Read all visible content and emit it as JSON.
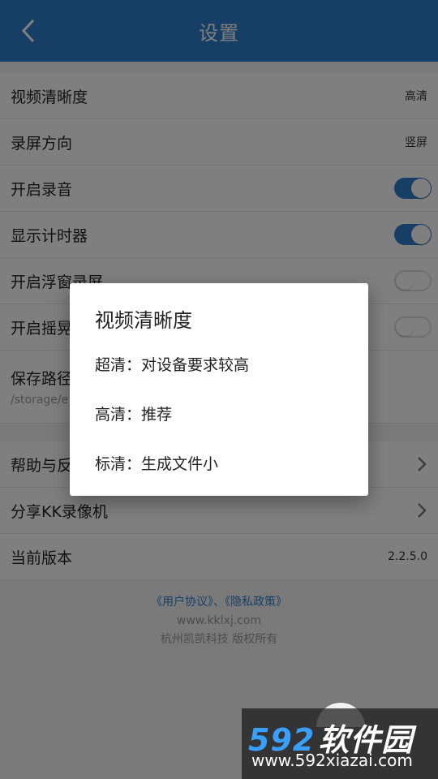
{
  "header": {
    "title": "设置",
    "back_icon": "chevron-left-icon"
  },
  "settings": {
    "video_quality": {
      "label": "视频清晰度",
      "value": "高清"
    },
    "record_orientation": {
      "label": "录屏方向",
      "value": "竖屏"
    },
    "record_audio": {
      "label": "开启录音",
      "enabled": true
    },
    "show_timer": {
      "label": "显示计时器",
      "enabled": true
    },
    "floating_window": {
      "label": "开启浮窗录屏",
      "enabled": false
    },
    "shake": {
      "label": "开启摇晃",
      "enabled": false
    },
    "save_path": {
      "label": "保存路径",
      "value": "/storage/e"
    }
  },
  "misc": {
    "help": {
      "label": "帮助与反"
    },
    "share": {
      "label": "分享KK录像机"
    },
    "version": {
      "label": "当前版本",
      "value": "2.2.5.0"
    }
  },
  "footer": {
    "links": "《用户协议》、《隐私政策》",
    "site": "www.kklxj.com",
    "copyright": "杭州凯凯科技 版权所有"
  },
  "dialog": {
    "title": "视频清晰度",
    "options": [
      "超清：对设备要求较高",
      "高清：推荐",
      "标清：生成文件小"
    ]
  },
  "watermark": {
    "logo_number": "592",
    "logo_text": "软件园",
    "url": "www.592xiazai.com"
  },
  "colors": {
    "accent": "#2f7fcd",
    "overlay": "rgba(0,0,0,0.5)"
  }
}
